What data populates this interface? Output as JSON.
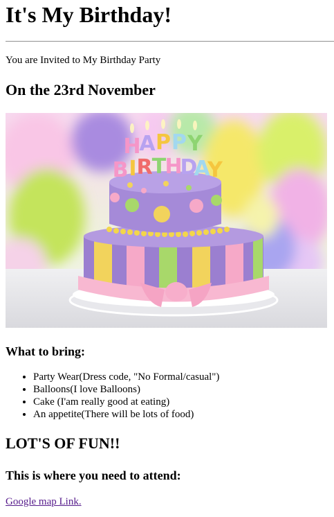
{
  "page": {
    "title": "It's My Birthday!",
    "invite_text": "You are Invited to My Birthday Party",
    "date_heading": "On the 23rd November",
    "cake_topper_text": "HAPPY BIRTHDAY",
    "bring_heading": "What to bring:",
    "bring_items": [
      "Party Wear(Dress code, \"No Formal/casual\")",
      "Balloons(I love Balloons)",
      "Cake (I'am really good at eating)",
      "An appetite(There will be lots of food)"
    ],
    "fun_heading": "LOT'S OF FUN!!",
    "attend_heading": "This is where you need to attend:",
    "map_link_text": "Google map Link."
  },
  "colors": {
    "link_visited": "#551a8b",
    "cake_purple": "#9b7fd0",
    "cake_pink": "#f6a9c8",
    "cake_yellow": "#f2d35c",
    "cake_green": "#a8d86a"
  }
}
